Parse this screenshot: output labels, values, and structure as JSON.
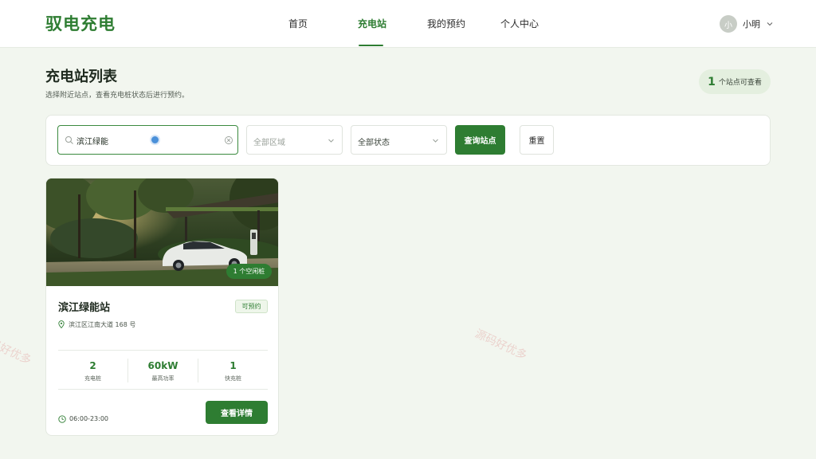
{
  "app": {
    "logo": "驭电充电"
  },
  "nav": {
    "items": [
      {
        "label": "首页",
        "active": false
      },
      {
        "label": "充电站",
        "active": true
      },
      {
        "label": "我的预约",
        "active": false
      },
      {
        "label": "个人中心",
        "active": false
      }
    ]
  },
  "user": {
    "avatar_text": "小",
    "name": "小明"
  },
  "page": {
    "title": "充电站列表",
    "subtitle": "选择附近站点，查看充电桩状态后进行预约。",
    "available_count": "1",
    "available_text": "个站点可查看"
  },
  "filters": {
    "search_value": "滨江绿能",
    "region_placeholder": "全部区域",
    "status_value": "全部状态",
    "search_button": "查询站点",
    "reset_button": "重置"
  },
  "stations": [
    {
      "idle_badge": "1 个空闲桩",
      "name": "滨江绿能站",
      "status_tag": "可预约",
      "address": "滨江区江南大道 168 号",
      "stats": [
        {
          "value": "2",
          "label": "充电桩"
        },
        {
          "value": "60kW",
          "label": "最高功率"
        },
        {
          "value": "1",
          "label": "快充桩"
        }
      ],
      "hours": "06:00-23:00",
      "detail_button": "查看详情"
    }
  ],
  "watermark": "源码好优多",
  "colors": {
    "brand": "#2e7d32",
    "background": "#f2f6ef"
  }
}
